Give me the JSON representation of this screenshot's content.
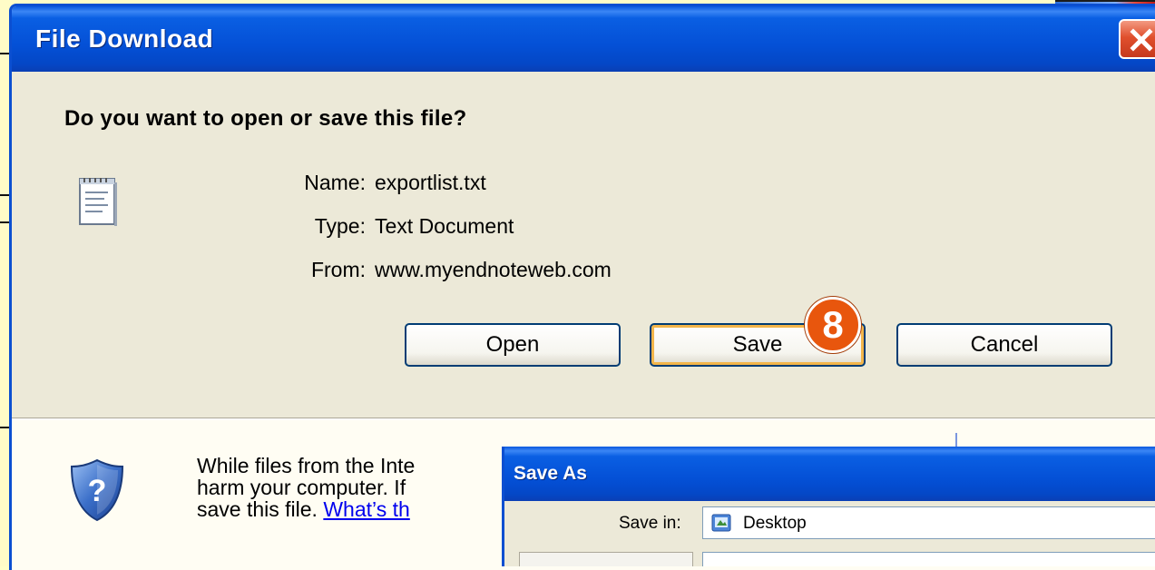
{
  "file_download": {
    "title": "File Download",
    "question": "Do you want to open or save this file?",
    "name_label": "Name:",
    "name_value": "exportlist.txt",
    "type_label": "Type:",
    "type_value": "Text Document",
    "from_label": "From:",
    "from_value": "www.myendnoteweb.com",
    "buttons": {
      "open": "Open",
      "save": "Save",
      "cancel": "Cancel"
    },
    "warning_line1": "While files from the Inte",
    "warning_line2": "harm your computer. If",
    "warning_line3_prefix": "save this file. ",
    "warning_link": "What’s th",
    "step_badge": "8"
  },
  "save_as": {
    "title": "Save As",
    "save_in_label": "Save in:",
    "save_in_value": "Desktop"
  },
  "colors": {
    "titlebar": "#0450d6",
    "dialog_bg": "#ece9d8",
    "page_bg": "#fffcc7",
    "badge": "#e8560d",
    "close_button": "#e0502d"
  },
  "icons": {
    "file": "text-document-icon",
    "shield": "security-shield-icon",
    "close": "close-icon",
    "desktop": "desktop-folder-icon"
  }
}
